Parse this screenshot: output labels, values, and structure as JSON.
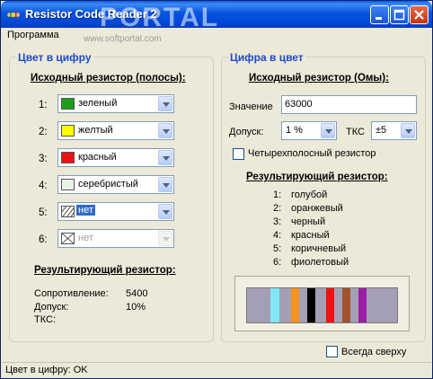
{
  "window": {
    "title": "Resistor Code Reader 2",
    "watermark": "PORTAL",
    "watermark_sub": "www.softportal.com"
  },
  "menu": {
    "program": "Программа"
  },
  "left_group": {
    "title": "Цвет в цифру",
    "heading": "Исходный резистор (полосы):",
    "bands": [
      {
        "num": "1:",
        "value": "зеленый",
        "color": "#1a9e1a",
        "swatch": "solid"
      },
      {
        "num": "2:",
        "value": "желтый",
        "color": "#ffff00",
        "swatch": "solid"
      },
      {
        "num": "3:",
        "value": "красный",
        "color": "#ee1111",
        "swatch": "solid"
      },
      {
        "num": "4:",
        "value": "серебристый",
        "color": "#e8f4e8",
        "swatch": "solid"
      },
      {
        "num": "5:",
        "value": "нет",
        "color": "#ffffff",
        "swatch": "hatched"
      },
      {
        "num": "6:",
        "value": "нет",
        "color": "#ffffff",
        "swatch": "cross"
      }
    ],
    "result_heading": "Результирующий резистор:",
    "resistance_label": "Сопротивление:",
    "resistance_value": "5400",
    "tolerance_label": "Допуск:",
    "tolerance_value": "10%",
    "tks_label": "ТКС:",
    "tks_value": ""
  },
  "right_group": {
    "title": "Цифра в цвет",
    "heading": "Исходный резистор (Омы):",
    "value_label": "Значение",
    "value_input": "63000",
    "tolerance_label": "Допуск:",
    "tolerance_value": "1 %",
    "tks_label": "ТКС",
    "tks_value": "±5",
    "four_band_label": "Четырехполосный резистор",
    "result_heading": "Результирующий резистор:",
    "result_bands": [
      {
        "num": "1:",
        "value": "голубой"
      },
      {
        "num": "2:",
        "value": "оранжевый"
      },
      {
        "num": "3:",
        "value": "черный"
      },
      {
        "num": "4:",
        "value": "красный"
      },
      {
        "num": "5:",
        "value": "коричневый"
      },
      {
        "num": "6:",
        "value": "фиолетовый"
      }
    ],
    "resistor_body_color": "#a59fb5",
    "resistor_band_colors": [
      "#7fe7f5",
      "#f7941d",
      "#000000",
      "#ee1111",
      "#a0522d",
      "#9b1fa5"
    ]
  },
  "always_on_top_label": "Всегда сверху",
  "status": "Цвет в цифру: OK",
  "colors": {
    "group_title": "#1c4bd0",
    "window_bg": "#ece9d8",
    "titlebar": "#0753e0"
  }
}
